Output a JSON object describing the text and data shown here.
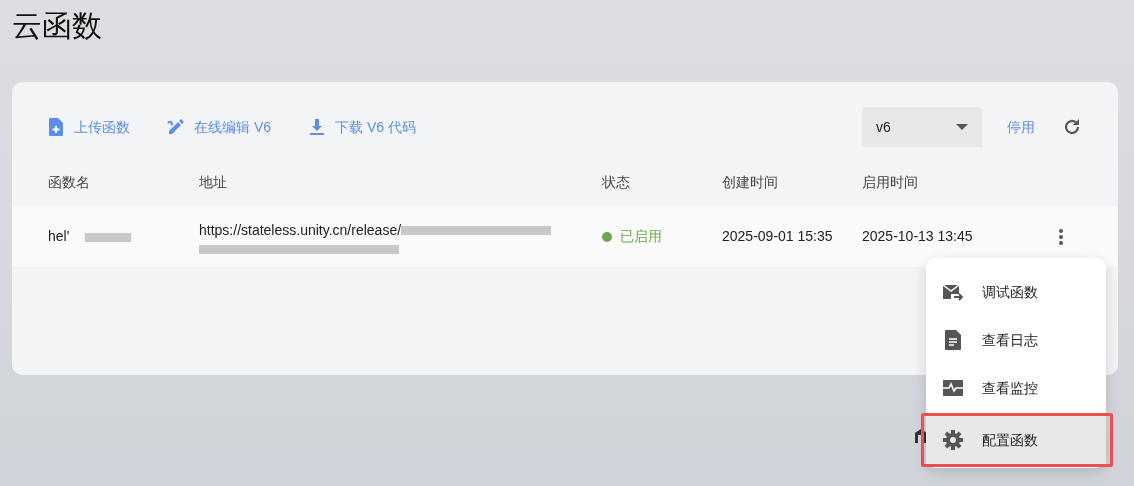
{
  "page": {
    "title": "云函数"
  },
  "toolbar": {
    "actions": [
      {
        "kind": "upload",
        "label": "上传函数"
      },
      {
        "kind": "edit",
        "label": "在线编辑 V6"
      },
      {
        "kind": "download",
        "label": "下载 V6 代码"
      }
    ],
    "version_select": {
      "value": "v6"
    },
    "disable_link": "停用"
  },
  "table": {
    "columns": [
      "函数名",
      "地址",
      "状态",
      "创建时间",
      "启用时间"
    ],
    "rows": [
      {
        "name": "hel'",
        "url": "https://stateless.unity.cn/release/",
        "status": "已启用",
        "color": "#6aa84f",
        "created": "2025-09-01 15:35",
        "enabled": "2025-10-13 13:45"
      }
    ]
  },
  "context_menu": {
    "items": [
      {
        "kind": "debug",
        "label": "调试函数",
        "selected": false
      },
      {
        "kind": "log",
        "label": "查看日志",
        "selected": false
      },
      {
        "kind": "monitor",
        "label": "查看监控",
        "selected": false
      },
      {
        "kind": "settings",
        "label": "配置函数",
        "selected": true
      }
    ]
  }
}
